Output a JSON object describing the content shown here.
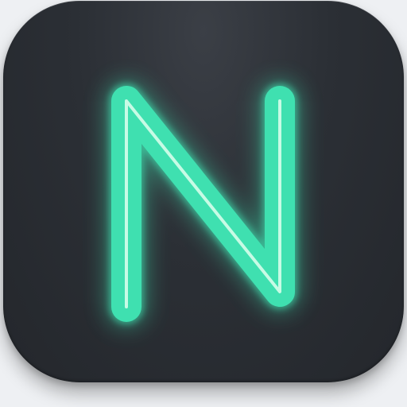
{
  "icon": {
    "glyph_name": "neon-letter-n-icon",
    "background_color": "#2b2f35",
    "neon_color": "#3fe0b0",
    "neon_core_color": "#dfffee"
  }
}
